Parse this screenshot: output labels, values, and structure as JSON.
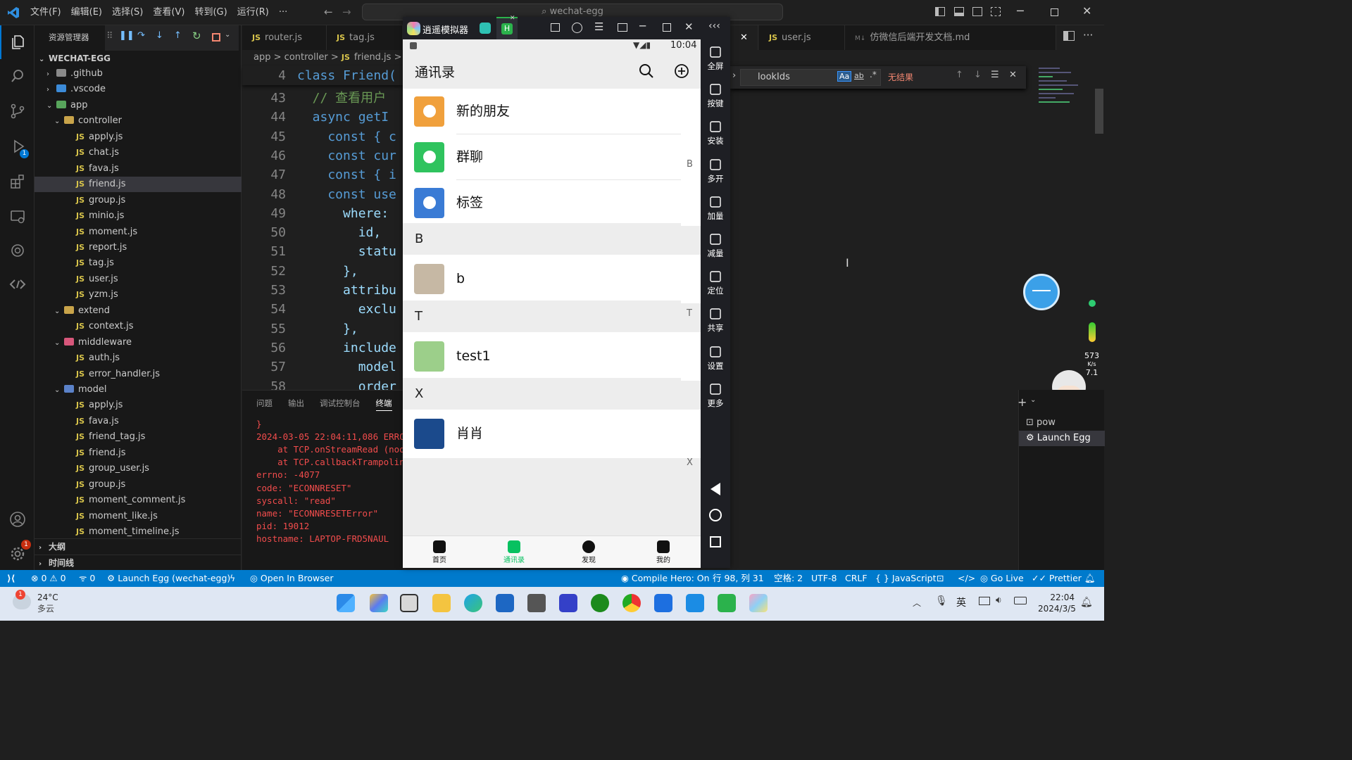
{
  "vscode": {
    "menu": [
      "文件(F)",
      "编辑(E)",
      "选择(S)",
      "查看(V)",
      "转到(G)",
      "运行(R)",
      "···"
    ],
    "command_center": "wechat-egg",
    "explorer_title": "资源管理器",
    "root": "WECHAT-EGG",
    "tree": [
      {
        "label": ".github",
        "type": "folder-closed",
        "indent": 1,
        "color": "#8a8a8a"
      },
      {
        "label": ".vscode",
        "type": "folder-closed",
        "indent": 1,
        "color": "#3c8bd8"
      },
      {
        "label": "app",
        "type": "folder-open",
        "indent": 1,
        "color": "#58a55c"
      },
      {
        "label": "controller",
        "type": "folder-open",
        "indent": 2,
        "color": "#c9a44a"
      },
      {
        "label": "apply.js",
        "type": "js",
        "indent": 3
      },
      {
        "label": "chat.js",
        "type": "js",
        "indent": 3
      },
      {
        "label": "fava.js",
        "type": "js",
        "indent": 3
      },
      {
        "label": "friend.js",
        "type": "js",
        "indent": 3,
        "selected": true
      },
      {
        "label": "group.js",
        "type": "js",
        "indent": 3
      },
      {
        "label": "minio.js",
        "type": "js",
        "indent": 3
      },
      {
        "label": "moment.js",
        "type": "js",
        "indent": 3
      },
      {
        "label": "report.js",
        "type": "js",
        "indent": 3
      },
      {
        "label": "tag.js",
        "type": "js",
        "indent": 3
      },
      {
        "label": "user.js",
        "type": "js",
        "indent": 3
      },
      {
        "label": "yzm.js",
        "type": "js",
        "indent": 3
      },
      {
        "label": "extend",
        "type": "folder-open",
        "indent": 2,
        "color": "#c9a44a"
      },
      {
        "label": "context.js",
        "type": "js",
        "indent": 3
      },
      {
        "label": "middleware",
        "type": "folder-open",
        "indent": 2,
        "color": "#d7577b"
      },
      {
        "label": "auth.js",
        "type": "js",
        "indent": 3
      },
      {
        "label": "error_handler.js",
        "type": "js",
        "indent": 3
      },
      {
        "label": "model",
        "type": "folder-open",
        "indent": 2,
        "color": "#5b82c9"
      },
      {
        "label": "apply.js",
        "type": "js",
        "indent": 3
      },
      {
        "label": "fava.js",
        "type": "js",
        "indent": 3
      },
      {
        "label": "friend_tag.js",
        "type": "js",
        "indent": 3
      },
      {
        "label": "friend.js",
        "type": "js",
        "indent": 3
      },
      {
        "label": "group_user.js",
        "type": "js",
        "indent": 3
      },
      {
        "label": "group.js",
        "type": "js",
        "indent": 3
      },
      {
        "label": "moment_comment.js",
        "type": "js",
        "indent": 3
      },
      {
        "label": "moment_like.js",
        "type": "js",
        "indent": 3
      },
      {
        "label": "moment_timeline.js",
        "type": "js",
        "indent": 3
      }
    ],
    "outline": "大纲",
    "timeline": "时间线",
    "tabs": [
      "router.js",
      "tag.js",
      "user.js",
      "仿微信后端开发文档.md"
    ],
    "breadcrumb": [
      "app",
      ">",
      "controller",
      ">",
      "JS",
      "friend.js",
      ">"
    ],
    "sticky_line": {
      "num": "4",
      "text": "class Friend("
    },
    "code": [
      {
        "num": "43",
        "text": "  // 查看用户",
        "cls": "cm"
      },
      {
        "num": "44",
        "text": "  async getI"
      },
      {
        "num": "45",
        "text": "    const { c"
      },
      {
        "num": "46",
        "text": "    const cur"
      },
      {
        "num": "47",
        "text": "    const { i"
      },
      {
        "num": "48",
        "text": "    const use"
      },
      {
        "num": "49",
        "text": "      where: "
      },
      {
        "num": "50",
        "text": "        id,"
      },
      {
        "num": "51",
        "text": "        statu"
      },
      {
        "num": "52",
        "text": "      },"
      },
      {
        "num": "53",
        "text": "      attribu"
      },
      {
        "num": "54",
        "text": "        exclu"
      },
      {
        "num": "55",
        "text": "      },"
      },
      {
        "num": "56",
        "text": "      include"
      },
      {
        "num": "57",
        "text": "        model"
      },
      {
        "num": "58",
        "text": "        order"
      }
    ],
    "find": {
      "value": "lookIds",
      "result": "无结果",
      "opt_case": "Aa",
      "opt_word": "ab"
    },
    "panel_tabs": [
      "问题",
      "输出",
      "调试控制台",
      "终端"
    ],
    "terminal": [
      "}",
      "2024-03-05 22:04:11,086 ERRO",
      "    at TCP.onStreamRead (nod",
      "    at TCP.callbackTrampolin",
      "errno: -4077",
      "code: \"ECONNRESET\"",
      "syscall: \"read\"",
      "name: \"ECONNRESETError\"",
      "pid: 19012",
      "hostname: LAPTOP-FRD5NAUL"
    ],
    "terminal_list": [
      "pow",
      "Launch Egg"
    ],
    "net_speed": "573",
    "net_unit": "K/s",
    "net_sub": "7.1",
    "status": {
      "errors": "0",
      "warnings": "0",
      "ports": "0",
      "launch": "Launch Egg (wechat-egg)",
      "browser": "Open In Browser",
      "compile": "Compile Hero: On",
      "position": "行 98, 列 31",
      "spaces": "空格: 2",
      "encoding": "UTF-8",
      "eol": "CRLF",
      "lang": "JavaScript",
      "golive": "Go Live",
      "prettier": "Prettier",
      "badge": "1"
    }
  },
  "emulator": {
    "title": "逍遥模拟器",
    "statusbar_time": "10:04",
    "header": "通讯录",
    "top_items": [
      {
        "label": "新的朋友",
        "color": "#f0a03c",
        "icon": "add-friend-icon"
      },
      {
        "label": "群聊",
        "color": "#2fc35e",
        "icon": "group-icon"
      },
      {
        "label": "标签",
        "color": "#3a7bd5",
        "icon": "tag-icon"
      }
    ],
    "groups": [
      {
        "letter": "B",
        "contacts": [
          {
            "name": "b",
            "avatar": "#c6b8a4"
          }
        ]
      },
      {
        "letter": "T",
        "contacts": [
          {
            "name": "test1",
            "avatar": "#9ccf8a"
          }
        ]
      },
      {
        "letter": "X",
        "contacts": [
          {
            "name": "肖肖",
            "avatar": "#1b4a8c"
          }
        ]
      }
    ],
    "index_letters": [
      "B",
      "T",
      "X"
    ],
    "side": [
      {
        "label": "全屏",
        "icon": "fullscreen-icon"
      },
      {
        "label": "按键",
        "icon": "keyboard-icon"
      },
      {
        "label": "安装",
        "icon": "apk-icon"
      },
      {
        "label": "多开",
        "icon": "multi-instance-icon"
      },
      {
        "label": "加量",
        "icon": "volume-up-icon"
      },
      {
        "label": "减量",
        "icon": "volume-down-icon"
      },
      {
        "label": "定位",
        "icon": "location-icon"
      },
      {
        "label": "共享",
        "icon": "folder-icon"
      },
      {
        "label": "设置",
        "icon": "gear-icon"
      },
      {
        "label": "更多",
        "icon": "more-icon"
      }
    ],
    "nav": [
      {
        "label": "首页",
        "active": false
      },
      {
        "label": "通讯录",
        "active": true
      },
      {
        "label": "发现",
        "active": false
      },
      {
        "label": "我的",
        "active": false
      }
    ]
  },
  "taskbar": {
    "weather_temp": "24°C",
    "weather_desc": "多云",
    "ime": "英",
    "time": "22:04",
    "date": "2024/3/5"
  },
  "colors": {
    "accent": "#007acc",
    "wechat_green": "#07c160",
    "error": "#f14c4c"
  }
}
